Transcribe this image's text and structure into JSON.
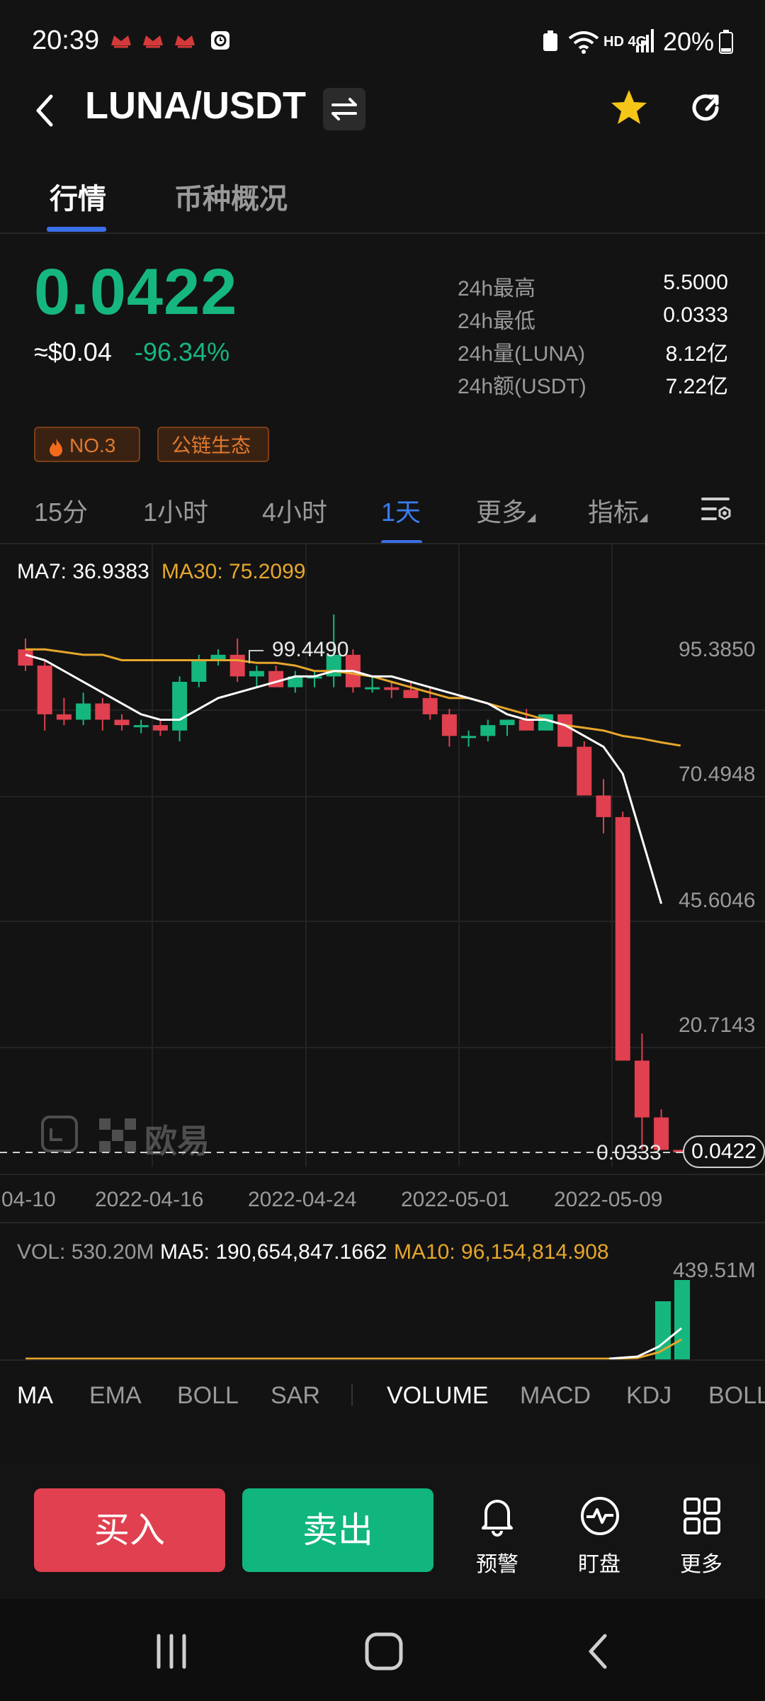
{
  "status_bar": {
    "time": "20:39",
    "network": "HD 4G",
    "battery": "20%"
  },
  "header": {
    "pair": "LUNA/USDT"
  },
  "tabs": [
    {
      "label": "行情"
    },
    {
      "label": "币种概况"
    }
  ],
  "ticker": {
    "price": "0.0422",
    "usd": "≈$0.04",
    "change": "-96.34%",
    "stats": [
      {
        "label": "24h最高",
        "value": "5.5000"
      },
      {
        "label": "24h最低",
        "value": "0.0333"
      },
      {
        "label": "24h量(LUNA)",
        "value": "8.12亿"
      },
      {
        "label": "24h额(USDT)",
        "value": "7.22亿"
      }
    ]
  },
  "tags": [
    {
      "label": "NO.3"
    },
    {
      "label": "公链生态"
    }
  ],
  "periods": [
    "15分",
    "1小时",
    "4小时",
    "1天",
    "更多",
    "指标"
  ],
  "chart": {
    "ma7_label": "MA7: 36.9383",
    "ma30_label": "MA30: 75.2099",
    "high_marker": "99.4490",
    "y_ticks": [
      "95.3850",
      "70.4948",
      "45.6046",
      "20.7143",
      "0.0333"
    ],
    "current_price_tag": "0.0422",
    "watermark": "欧易",
    "dates": [
      "04-10",
      "2022-04-16",
      "2022-04-24",
      "2022-05-01",
      "2022-05-09"
    ],
    "colors": {
      "up": "#16b77f",
      "down": "#e0404f",
      "ma7": "#ffffff",
      "ma30": "#e6a62c"
    }
  },
  "volume": {
    "vol_label": "VOL: 530.20M",
    "ma5_label": "MA5: 190,654,847.1662",
    "ma10_label": "MA10: 96,154,814.908",
    "max_label": "439.51M"
  },
  "indicators_main": [
    "MA",
    "EMA",
    "BOLL",
    "SAR"
  ],
  "indicators_sub": [
    "VOLUME",
    "MACD",
    "KDJ",
    "BOLL"
  ],
  "actions": {
    "buy": "买入",
    "sell": "卖出",
    "alert": "预警",
    "watch": "盯盘",
    "more": "更多"
  },
  "chart_data": {
    "type": "candlestick",
    "series": [
      {
        "name": "LUNA/USDT 1天",
        "ohlc": [
          [
            93,
            95,
            89,
            90
          ],
          [
            90,
            91,
            78,
            81
          ],
          [
            81,
            84,
            79,
            80
          ],
          [
            80,
            85,
            79,
            83
          ],
          [
            83,
            84,
            78,
            80
          ],
          [
            80,
            81,
            78,
            79
          ],
          [
            79,
            80,
            77.5,
            79
          ],
          [
            79,
            80,
            77,
            78
          ],
          [
            78,
            88,
            76,
            87
          ],
          [
            87,
            92,
            86,
            91
          ],
          [
            91,
            93,
            90,
            92
          ],
          [
            92,
            95,
            87,
            88
          ],
          [
            88,
            90,
            86,
            89
          ],
          [
            89,
            90,
            87,
            86
          ],
          [
            86,
            89,
            85,
            88
          ],
          [
            88,
            89,
            86,
            88
          ],
          [
            88,
            99.45,
            86,
            92
          ],
          [
            92,
            93,
            85,
            86
          ],
          [
            86,
            88,
            85,
            86
          ],
          [
            86,
            87,
            84,
            85.5
          ],
          [
            85.5,
            87,
            84,
            84
          ],
          [
            84,
            86,
            80,
            81
          ],
          [
            81,
            82,
            75,
            77
          ],
          [
            77,
            78,
            75,
            77
          ],
          [
            77,
            80,
            76,
            79
          ],
          [
            79,
            80,
            77,
            80
          ],
          [
            80,
            82,
            78,
            78
          ],
          [
            78,
            81,
            78,
            81
          ],
          [
            81,
            81,
            75,
            75
          ],
          [
            75,
            76,
            67,
            66
          ],
          [
            66,
            69,
            59,
            62
          ],
          [
            62,
            63,
            17,
            17
          ],
          [
            17,
            22,
            0.5,
            6.5
          ],
          [
            6.5,
            8,
            0.5,
            0.5
          ],
          [
            0.5,
            0.5,
            0.0333,
            0.0422
          ]
        ]
      }
    ],
    "ylim": [
      0.0333,
      99.449
    ],
    "y_ticks": [
      95.385,
      70.4948,
      45.6046,
      20.7143,
      0.0333
    ],
    "x_tick_labels": [
      "04-10",
      "2022-04-16",
      "2022-04-24",
      "2022-05-01",
      "2022-05-09"
    ],
    "ma7": [
      92,
      91,
      89,
      87,
      85,
      83,
      81,
      80,
      80,
      82,
      84,
      85,
      86,
      87,
      88,
      88,
      89,
      89,
      88,
      88,
      87,
      86,
      85,
      84,
      83,
      81,
      80,
      80,
      79,
      77,
      75,
      70,
      58,
      46,
      36.9383
    ],
    "ma30_partial": [
      93,
      93,
      92.5,
      92,
      92,
      91,
      91,
      91,
      91,
      91,
      91,
      91,
      90.5,
      90.5,
      90,
      89,
      89,
      88.5,
      88,
      87,
      86,
      85,
      84,
      84,
      83,
      82,
      81,
      80,
      79,
      78.5,
      78,
      77,
      76.5,
      75.8,
      75.2099
    ],
    "volume_max_label": "439.51M"
  }
}
